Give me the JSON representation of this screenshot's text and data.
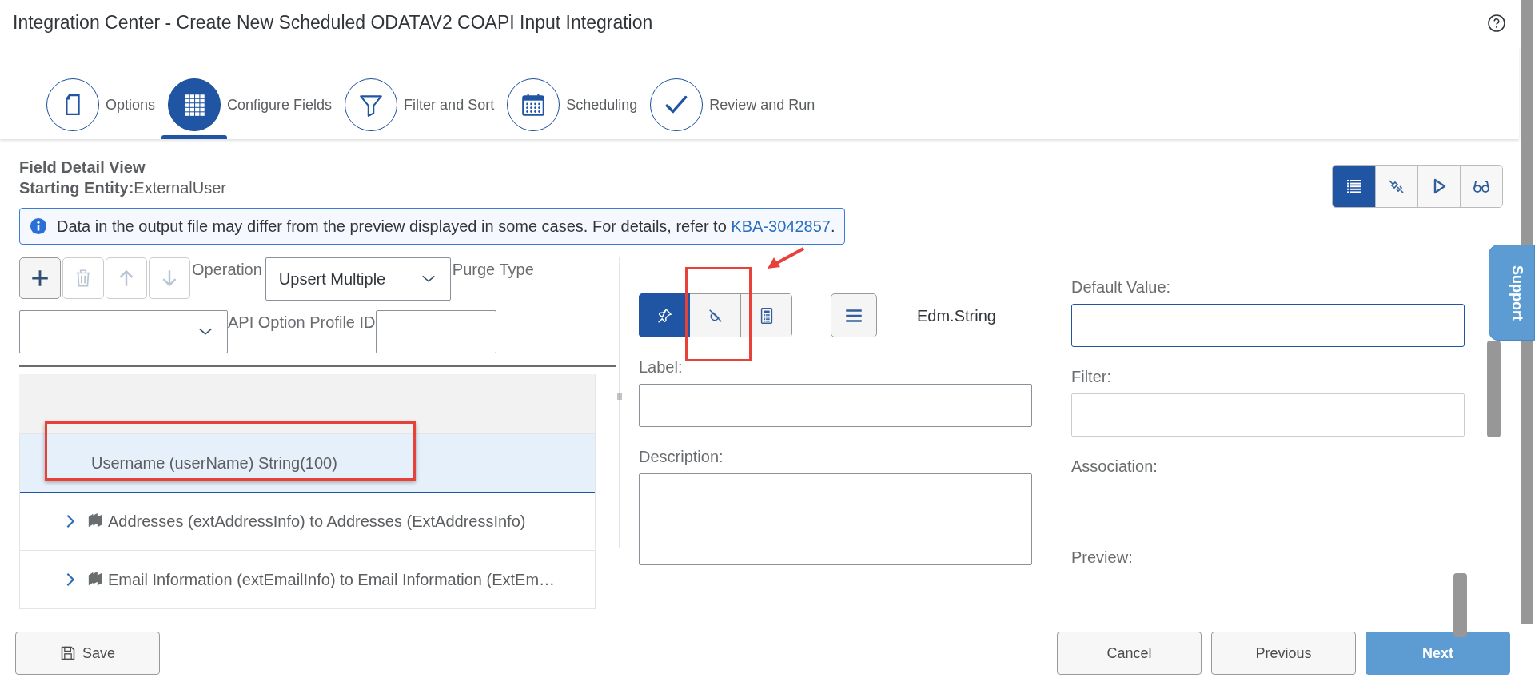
{
  "window": {
    "title": "Integration Center - Create New Scheduled ODATAV2 COAPI Input Integration"
  },
  "steps": [
    {
      "label": "Options",
      "kind": "document",
      "selected": false
    },
    {
      "label": "Configure Fields",
      "kind": "grid",
      "selected": true
    },
    {
      "label": "Filter and Sort",
      "kind": "funnel",
      "selected": false
    },
    {
      "label": "Scheduling",
      "kind": "calendar",
      "selected": false
    },
    {
      "label": "Review and Run",
      "kind": "check",
      "selected": false
    }
  ],
  "header": {
    "title": "Field Detail View",
    "entity_label": "Starting Entity:",
    "entity_value": "ExternalUser"
  },
  "view_toggle": [
    {
      "kind": "list",
      "selected": true
    },
    {
      "kind": "plug",
      "selected": false
    },
    {
      "kind": "play",
      "selected": false
    },
    {
      "kind": "glasses",
      "selected": false
    }
  ],
  "info": {
    "text": "Data in the output file may differ from the preview displayed in some cases. For details, refer to ",
    "link": "KBA-3042857",
    "suffix": "."
  },
  "toolbar": [
    {
      "kind": "add",
      "disabled": false
    },
    {
      "kind": "delete",
      "disabled": true
    },
    {
      "kind": "up",
      "disabled": true
    },
    {
      "kind": "down",
      "disabled": true
    }
  ],
  "operation": {
    "label": "Operation",
    "value": "Upsert Multiple"
  },
  "purge_type": {
    "label": "Purge Type"
  },
  "api_option_profile": {
    "label": "API Option Profile ID"
  },
  "tree_rows": [
    {
      "text": "Username (userName) String(100)",
      "selected": true,
      "expandable": false
    },
    {
      "text": "Addresses (extAddressInfo) to Addresses (ExtAddressInfo)",
      "selected": false,
      "expandable": true
    },
    {
      "text": "Email Information (extEmailInfo) to Email Information (ExtEm…",
      "selected": false,
      "expandable": true
    }
  ],
  "mode_buttons": [
    {
      "kind": "pin",
      "selected": true
    },
    {
      "kind": "unlink",
      "selected": false
    },
    {
      "kind": "calculator",
      "selected": false
    }
  ],
  "data_type": "Edm.String",
  "left_fields": [
    {
      "label": "Label:",
      "kind": "input"
    },
    {
      "label": "Description:",
      "kind": "textarea"
    }
  ],
  "right_fields": [
    {
      "label": "Default Value:",
      "kind": "input",
      "focused": true
    },
    {
      "label": "Filter:",
      "kind": "input",
      "focused": false
    },
    {
      "label": "Association:",
      "kind": "text"
    },
    {
      "label": "Preview:",
      "kind": "text"
    }
  ],
  "support": "Support",
  "footer": {
    "save": "Save",
    "cancel": "Cancel",
    "previous": "Previous",
    "next": "Next"
  },
  "annotations": [
    {
      "kind": "box"
    },
    {
      "kind": "arrow"
    },
    {
      "kind": "box"
    }
  ]
}
